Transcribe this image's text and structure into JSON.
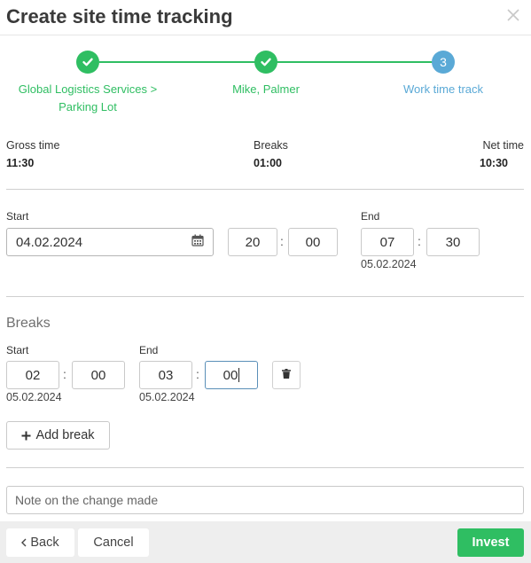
{
  "dialog": {
    "title": "Create site time tracking"
  },
  "stepper": {
    "steps": [
      {
        "label_line1": "Global Logistics Services >",
        "label_line2": "Parking Lot",
        "status": "done"
      },
      {
        "label_line1": "Mike, Palmer",
        "status": "done"
      },
      {
        "number": "3",
        "label_line1": "Work time track",
        "status": "current"
      }
    ]
  },
  "summary": {
    "gross": {
      "label": "Gross time",
      "value": "11:30"
    },
    "breaks": {
      "label": "Breaks",
      "value": "01:00"
    },
    "net": {
      "label": "Net time",
      "value": "10:30"
    }
  },
  "work": {
    "start_label": "Start",
    "start_date": "04.02.2024",
    "start_hour": "20",
    "start_minute": "00",
    "end_label": "End",
    "end_hour": "07",
    "end_minute": "30",
    "end_date": "05.02.2024",
    "time_separator": ":"
  },
  "breaks": {
    "title": "Breaks",
    "items": [
      {
        "start_label": "Start",
        "start_hour": "02",
        "start_minute": "00",
        "start_date": "05.02.2024",
        "end_label": "End",
        "end_hour": "03",
        "end_minute": "00",
        "end_date": "05.02.2024"
      }
    ],
    "add_label": "Add break"
  },
  "note": {
    "placeholder": "Note on the change made"
  },
  "footer": {
    "back_label": "Back",
    "cancel_label": "Cancel",
    "invest_label": "Invest"
  },
  "colors": {
    "success": "#2fbe62",
    "current_step": "#5aa9d6",
    "focus_border": "#5a8fb8"
  },
  "icons": [
    "close-icon",
    "check-icon",
    "calendar-icon",
    "trash-icon",
    "plus-icon",
    "chevron-left-icon"
  ]
}
